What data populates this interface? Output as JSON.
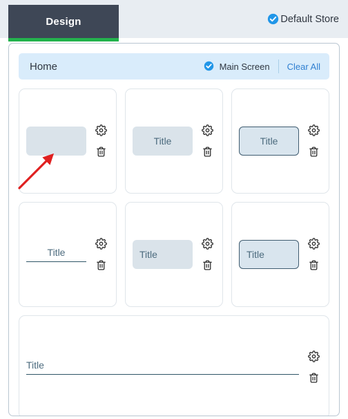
{
  "topbar": {
    "active_tab": "Design",
    "store": {
      "label": "Default Store",
      "icon": "check-circle-icon",
      "icon_color": "#2196e8"
    },
    "active_tab_bg": "#3e4756",
    "active_tab_underline_color": "#22b24c",
    "bg": "#e8edf2"
  },
  "screen_header": {
    "name": "Home",
    "main_screen_label": "Main Screen",
    "main_screen_icon": "check-circle-icon",
    "clear_all_label": "Clear All",
    "bg": "#d9ecfb",
    "link_color": "#2f7fd1"
  },
  "icons": {
    "settings": "gear-icon",
    "delete": "trash-icon"
  },
  "annotation": {
    "type": "arrow",
    "color": "#e02020",
    "points_to": "card-1-field"
  },
  "cards": [
    {
      "id": "card-1",
      "widget_style": "filled",
      "align": "left",
      "title": "",
      "empty": true,
      "wide": false
    },
    {
      "id": "card-2",
      "widget_style": "filled",
      "align": "center",
      "title": "Title",
      "empty": false,
      "wide": false
    },
    {
      "id": "card-3",
      "widget_style": "outlined",
      "align": "center",
      "title": "Title",
      "empty": false,
      "wide": false
    },
    {
      "id": "card-4",
      "widget_style": "underline",
      "align": "center",
      "title": "Title",
      "empty": false,
      "wide": false
    },
    {
      "id": "card-5",
      "widget_style": "filled",
      "align": "left",
      "title": "Title",
      "empty": false,
      "wide": false
    },
    {
      "id": "card-6",
      "widget_style": "outlined",
      "align": "left",
      "title": "Title",
      "empty": false,
      "wide": false
    },
    {
      "id": "card-7",
      "widget_style": "underline",
      "align": "left",
      "title": "Title",
      "empty": false,
      "wide": true
    }
  ]
}
